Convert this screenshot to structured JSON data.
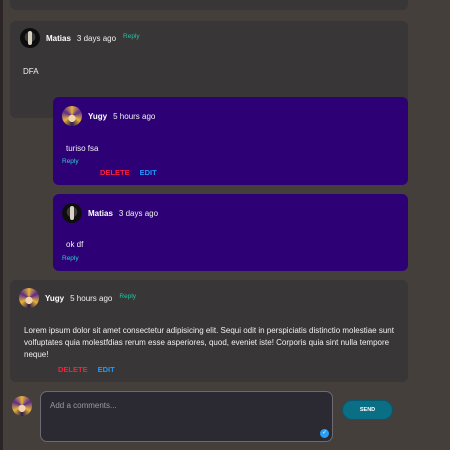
{
  "comments": [
    {
      "author": "Matias",
      "time": "3 days ago",
      "reply": "Reply",
      "text": "DFA",
      "avatar_icon": "matias-avatar"
    },
    {
      "author": "Yugy",
      "time": "5 hours ago",
      "text": "turiso fsa",
      "reply": "Reply",
      "delete": "DELETE",
      "edit": "EDIT",
      "avatar_icon": "yugy-avatar"
    },
    {
      "author": "Matias",
      "time": "3 days ago",
      "text": "ok df",
      "reply": "Reply",
      "avatar_icon": "matias-avatar"
    },
    {
      "author": "Yugy",
      "time": "5 hours ago",
      "reply": "Reply",
      "text": "Lorem ipsum dolor sit amet consectetur adipisicing elit. Sequi odit in perspiciatis distinctio molestiae sunt volfuptates quia molestfdias rerum esse asperiores, quod, eveniet iste! Corporis quia sint nulla tempore neque!",
      "delete": "DELETE",
      "edit": "EDIT",
      "avatar_icon": "yugy-avatar"
    }
  ],
  "composer": {
    "placeholder": "Add a comments...",
    "send_label": "SEND",
    "avatar_icon": "yugy-avatar"
  },
  "colors": {
    "background": "#453f3c",
    "card_dark": "#383636",
    "card_purple": "#2d0075",
    "delete": "#ff1e3c",
    "edit": "#1e9bff",
    "reply": "#1ec8a8",
    "send": "#0a6e84"
  }
}
